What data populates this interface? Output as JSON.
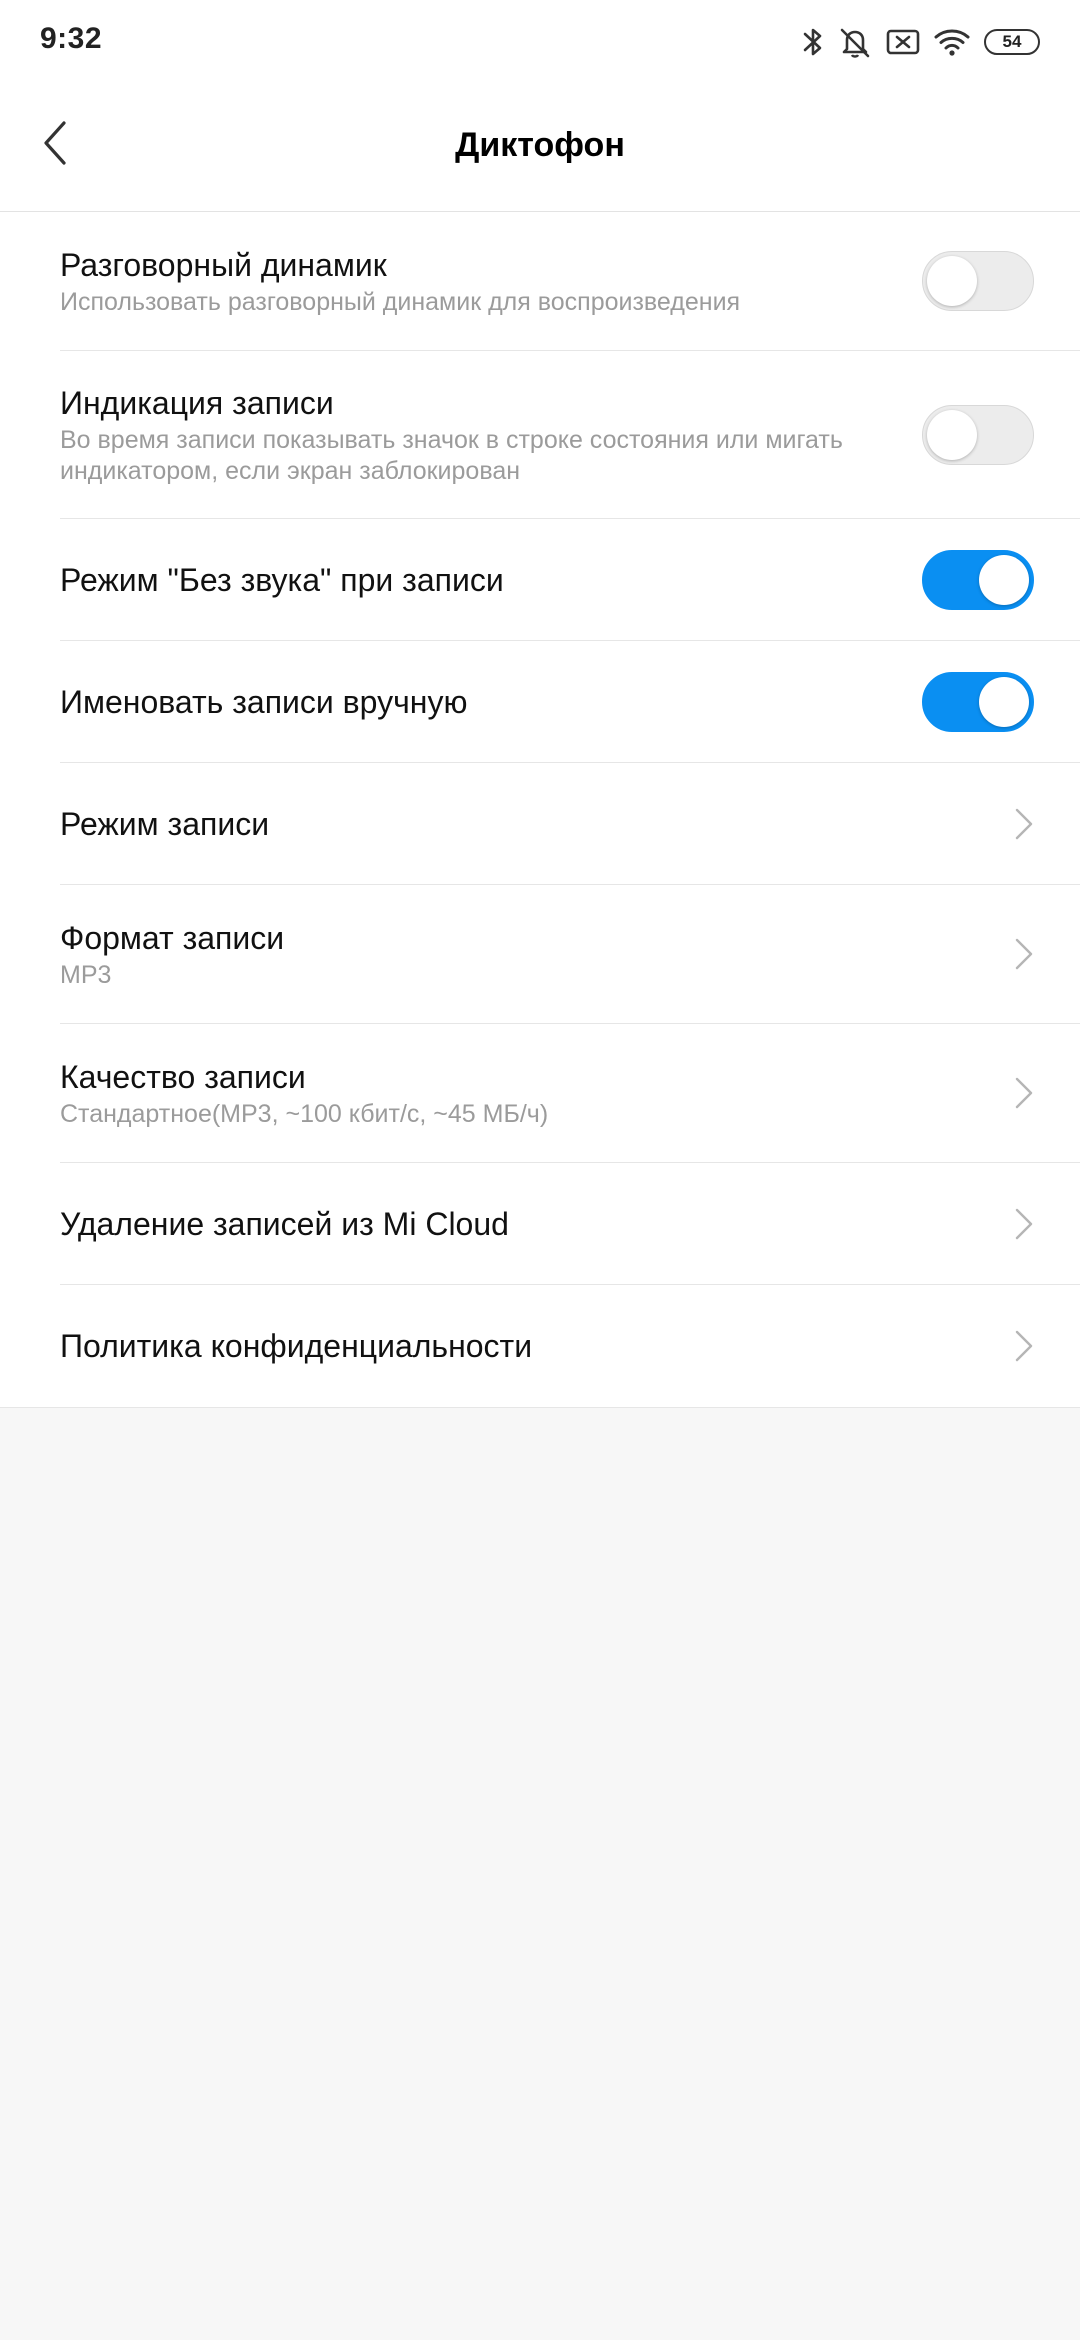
{
  "status": {
    "time": "9:32",
    "battery": "54",
    "icons": [
      "bluetooth-icon",
      "bell-off-icon",
      "sim-off-icon",
      "wifi-icon"
    ]
  },
  "header": {
    "title": "Диктофон",
    "back_icon": "chevron-left-icon"
  },
  "colors": {
    "accent": "#0a8ff2",
    "toggle_off": "#ececec",
    "subtitle": "#9b9b9b",
    "background": "#f7f7f7"
  },
  "settings": [
    {
      "title": "Разговорный динамик",
      "subtitle": "Использовать разговорный динамик для воспроизведения",
      "control": "toggle",
      "on": false
    },
    {
      "title": "Индикация записи",
      "subtitle": "Во время записи показывать значок в строке состояния или мигать индикатором, если экран заблокирован",
      "control": "toggle",
      "on": false
    },
    {
      "title": "Режим \"Без звука\" при записи",
      "subtitle": "",
      "control": "toggle",
      "on": true
    },
    {
      "title": "Именовать записи вручную",
      "subtitle": "",
      "control": "toggle",
      "on": true
    },
    {
      "title": "Режим записи",
      "subtitle": "",
      "control": "chevron"
    },
    {
      "title": "Формат записи",
      "subtitle": "MP3",
      "control": "chevron"
    },
    {
      "title": "Качество записи",
      "subtitle": "Стандартное(MP3, ~100 кбит/с, ~45 МБ/ч)",
      "control": "chevron"
    },
    {
      "title": "Удаление записей из Mi Cloud",
      "subtitle": "",
      "control": "chevron"
    },
    {
      "title": "Политика конфиденциальности",
      "subtitle": "",
      "control": "chevron"
    }
  ]
}
